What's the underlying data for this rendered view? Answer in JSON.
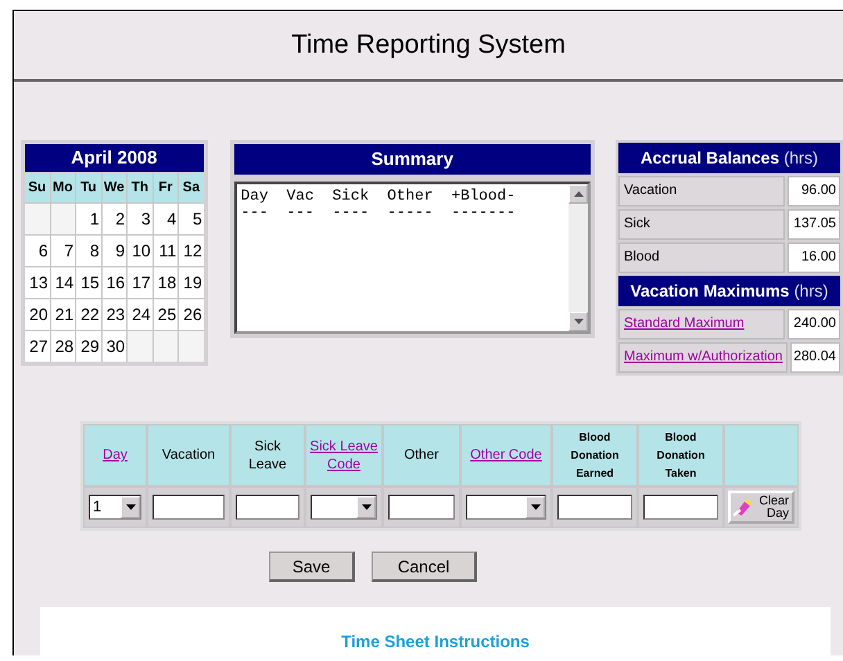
{
  "title": "Time Reporting System",
  "calendar": {
    "month": "April 2008",
    "weekdays": [
      "Su",
      "Mo",
      "Tu",
      "We",
      "Th",
      "Fr",
      "Sa"
    ],
    "weeks": [
      [
        {
          "kind": "blank"
        },
        {
          "kind": "blank"
        },
        {
          "kind": "day",
          "label": "1"
        },
        {
          "kind": "day",
          "label": "2"
        },
        {
          "kind": "day",
          "label": "3"
        },
        {
          "kind": "day",
          "label": "4"
        },
        {
          "kind": "day",
          "label": "5"
        }
      ],
      [
        {
          "kind": "day",
          "label": "6"
        },
        {
          "kind": "day",
          "label": "7"
        },
        {
          "kind": "day",
          "label": "8"
        },
        {
          "kind": "day",
          "label": "9"
        },
        {
          "kind": "day",
          "label": "10"
        },
        {
          "kind": "day",
          "label": "11"
        },
        {
          "kind": "day",
          "label": "12"
        }
      ],
      [
        {
          "kind": "day",
          "label": "13"
        },
        {
          "kind": "day",
          "label": "14"
        },
        {
          "kind": "day",
          "label": "15"
        },
        {
          "kind": "day",
          "label": "16"
        },
        {
          "kind": "day",
          "label": "17"
        },
        {
          "kind": "day",
          "label": "18"
        },
        {
          "kind": "day",
          "label": "19"
        }
      ],
      [
        {
          "kind": "day",
          "label": "20"
        },
        {
          "kind": "day",
          "label": "21"
        },
        {
          "kind": "day",
          "label": "22"
        },
        {
          "kind": "day",
          "label": "23"
        },
        {
          "kind": "day",
          "label": "24"
        },
        {
          "kind": "day",
          "label": "25"
        },
        {
          "kind": "day",
          "label": "26"
        }
      ],
      [
        {
          "kind": "day",
          "label": "27"
        },
        {
          "kind": "day",
          "label": "28"
        },
        {
          "kind": "day",
          "label": "29"
        },
        {
          "kind": "day",
          "label": "30"
        },
        {
          "kind": "blank"
        },
        {
          "kind": "blank"
        },
        {
          "kind": "blank"
        }
      ]
    ]
  },
  "summary": {
    "title": "Summary",
    "lines": [
      "Day  Vac  Sick  Other  +Blood-",
      "---  ---  ----  -----  -------"
    ]
  },
  "accrual": {
    "title": "Accrual Balances",
    "unit": "(hrs)",
    "rows": [
      {
        "label": "Vacation",
        "value": "96.00",
        "link": false
      },
      {
        "label": "Sick",
        "value": "137.05",
        "link": false
      },
      {
        "label": "Blood",
        "value": "16.00",
        "link": false
      }
    ]
  },
  "maximums": {
    "title": "Vacation Maximums",
    "unit": "(hrs)",
    "rows": [
      {
        "label": "Standard Maximum",
        "value": "240.00",
        "link": true
      },
      {
        "label": "Maximum w/Authorization",
        "value": "280.04",
        "link": true
      }
    ]
  },
  "entry": {
    "columns": [
      {
        "kind": "link",
        "label": "Day"
      },
      {
        "kind": "text",
        "label": "Vacation"
      },
      {
        "kind": "text",
        "label": "Sick Leave"
      },
      {
        "kind": "link",
        "label": "Sick Leave Code"
      },
      {
        "kind": "text",
        "label": "Other"
      },
      {
        "kind": "link",
        "label": "Other Code"
      },
      {
        "kind": "small",
        "label": "Blood Donation Earned"
      },
      {
        "kind": "small",
        "label": "Blood Donation Taken"
      },
      {
        "kind": "blank"
      }
    ],
    "cells": [
      {
        "kind": "select",
        "value": "1"
      },
      {
        "kind": "input"
      },
      {
        "kind": "input"
      },
      {
        "kind": "select"
      },
      {
        "kind": "input"
      },
      {
        "kind": "select"
      },
      {
        "kind": "input"
      },
      {
        "kind": "input"
      },
      {
        "kind": "button",
        "label": "Clear Day"
      }
    ]
  },
  "buttons": [
    "Save",
    "Cancel"
  ],
  "instructions": {
    "title": "Time Sheet Instructions"
  }
}
